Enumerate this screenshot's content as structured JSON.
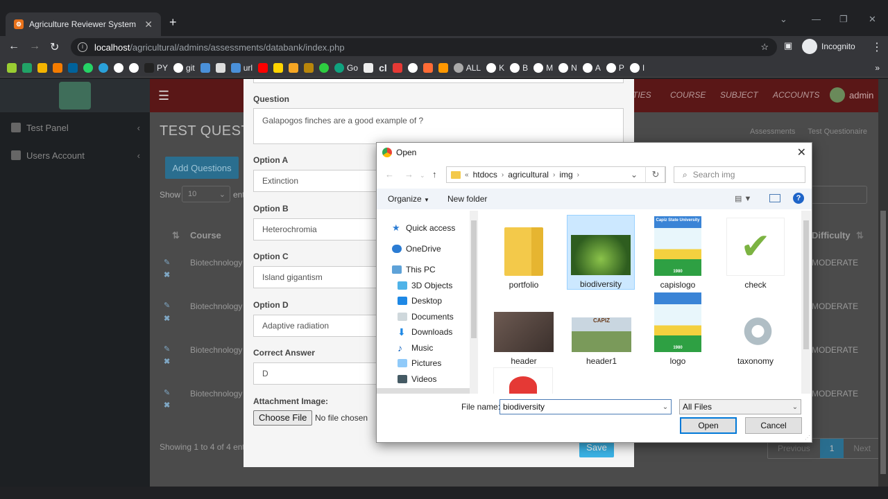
{
  "browser": {
    "tab_title": "Agriculture Reviewer System",
    "url_host": "localhost",
    "url_path": "/agricultural/admins/assessments/databank/index.php",
    "incognito": "Incognito",
    "bookmarks": [
      "PY",
      "git",
      "url",
      "Go",
      "cl",
      "ALL",
      "K",
      "B",
      "M",
      "N",
      "A",
      "P",
      "I"
    ]
  },
  "sidebar": {
    "items": [
      {
        "label": "Test Panel"
      },
      {
        "label": "Users Account"
      }
    ]
  },
  "topnav": {
    "links": [
      "TIES",
      "COURSE",
      "SUBJECT",
      "ACCOUNTS"
    ],
    "user": "admin"
  },
  "page": {
    "title": "TEST QUESTI",
    "breadcrumb": [
      "Assessments",
      "Test Questionaire"
    ],
    "add_button": "Add Questions",
    "show_label": "Show",
    "show_value": "10",
    "entries_label": "ent",
    "col_course": "Course",
    "col_difficulty": "Difficulty",
    "rows": [
      {
        "course": "Biotechnology",
        "difficulty": "MODERATE"
      },
      {
        "course": "Biotechnology",
        "difficulty": "MODERATE"
      },
      {
        "course": "Biotechnology",
        "difficulty": "MODERATE"
      },
      {
        "course": "Biotechnology",
        "difficulty": "MODERATE"
      }
    ],
    "showing": "Showing 1 to 4 of 4 ent",
    "pager": {
      "previous": "Previous",
      "current": "1",
      "next": "Next"
    }
  },
  "modal": {
    "question_label": "Question",
    "question_value": "Galapogos finches are a good example of ?",
    "option_a_label": "Option A",
    "option_a_value": "Extinction",
    "option_b_label": "Option B",
    "option_b_value": "Heterochromia",
    "option_c_label": "Option C",
    "option_c_value": "Island gigantism",
    "option_d_label": "Option D",
    "option_d_value": "Adaptive radiation",
    "correct_label": "Correct Answer",
    "correct_value": "D",
    "attachment_label": "Attachment Image:",
    "choose_file": "Choose File",
    "no_file": "No file chosen",
    "save": "Save"
  },
  "dialog": {
    "title": "Open",
    "path": [
      "htdocs",
      "agricultural",
      "img"
    ],
    "path_prefix": "«",
    "search_placeholder": "Search img",
    "organize": "Organize",
    "new_folder": "New folder",
    "nav": [
      "Quick access",
      "OneDrive",
      "This PC",
      "3D Objects",
      "Desktop",
      "Documents",
      "Downloads",
      "Music",
      "Pictures",
      "Videos"
    ],
    "files": [
      "portfolio",
      "biodiversity",
      "capislogo",
      "check",
      "header",
      "header1",
      "logo",
      "taxonomy"
    ],
    "capis_text": "Capiz State University",
    "capis_year": "1980",
    "header1_text": "CAPIZ",
    "file_name_label": "File name:",
    "file_name_value": "biodiversity",
    "file_type": "All Files",
    "open_button": "Open",
    "cancel_button": "Cancel"
  },
  "colors": {
    "topnav": "#5a1717",
    "accent": "#2a6e8f",
    "save": "#3bb3e6",
    "selection": "#cce8ff"
  }
}
